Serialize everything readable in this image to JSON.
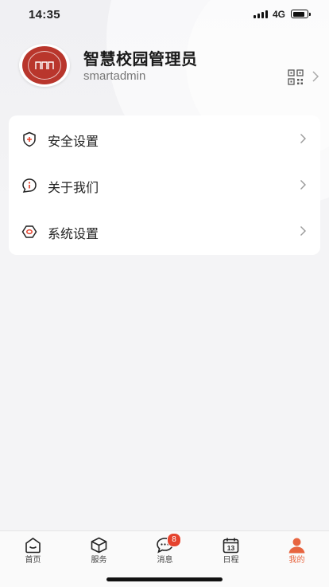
{
  "status_bar": {
    "time": "14:35",
    "network": "4G"
  },
  "profile": {
    "name": "智慧校园管理员",
    "account": "smartadmin"
  },
  "menu": {
    "items": [
      {
        "label": "安全设置",
        "icon": "shield-icon"
      },
      {
        "label": "关于我们",
        "icon": "info-bubble-icon"
      },
      {
        "label": "系统设置",
        "icon": "hexagon-settings-icon"
      }
    ]
  },
  "tabbar": {
    "tabs": [
      {
        "label": "首页",
        "icon": "home-icon"
      },
      {
        "label": "服务",
        "icon": "cube-icon"
      },
      {
        "label": "消息",
        "icon": "chat-icon",
        "badge": "8"
      },
      {
        "label": "日程",
        "icon": "calendar-icon",
        "calendar_day": "13"
      },
      {
        "label": "我的",
        "icon": "user-icon",
        "active": true
      }
    ]
  },
  "colors": {
    "accent": "#e7643f",
    "badge": "#e5432e",
    "seal": "#b9362c"
  }
}
